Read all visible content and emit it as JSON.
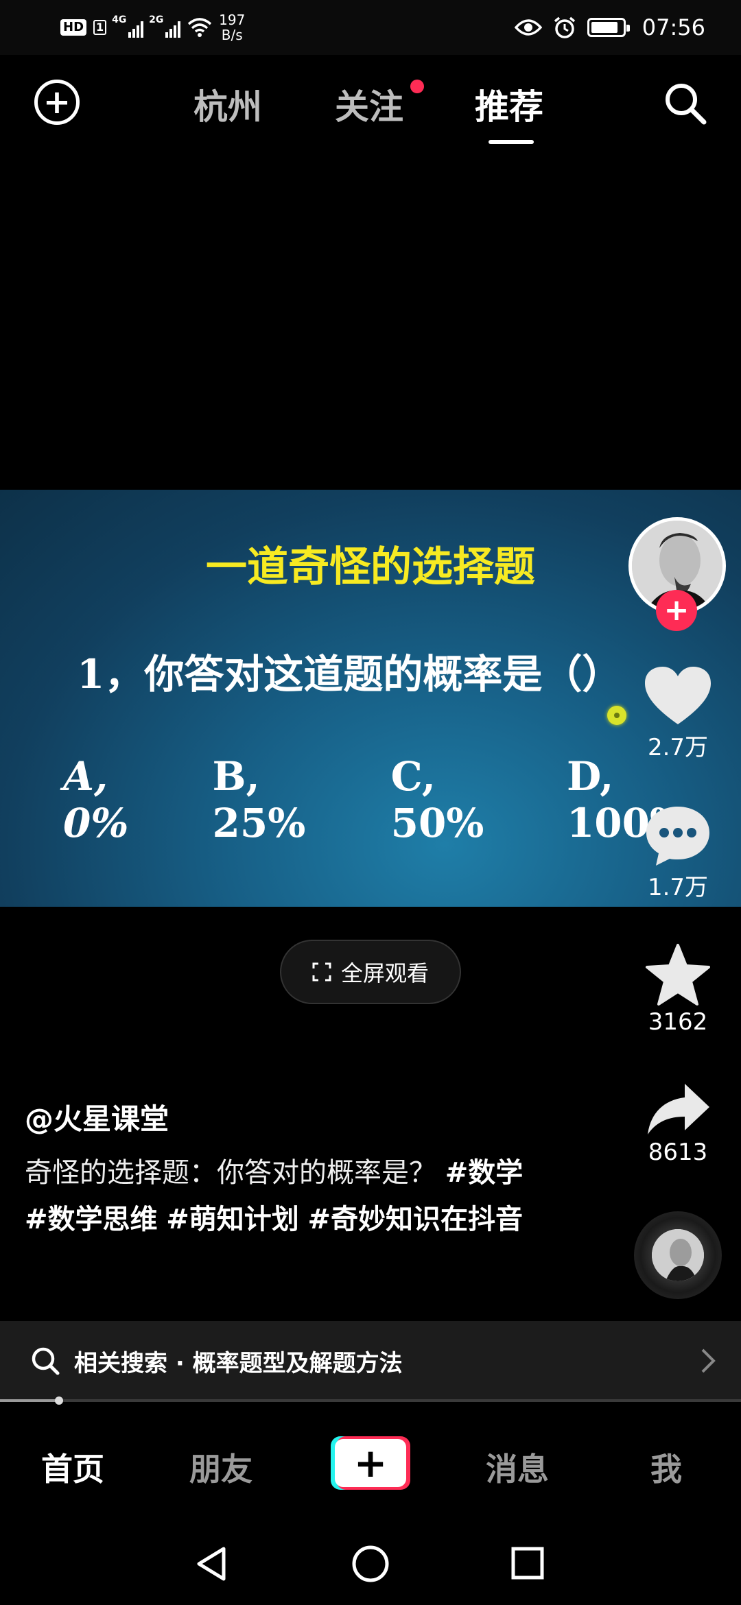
{
  "status_bar": {
    "hd": "HD",
    "sim": "1",
    "net1": "4G",
    "net2": "2G",
    "speed_value": "197",
    "speed_unit": "B/s",
    "time": "07:56"
  },
  "top_nav": {
    "tabs": [
      "杭州",
      "关注",
      "推荐"
    ],
    "active_tab": "推荐",
    "notification_dot_color": "#fe2c55"
  },
  "video": {
    "title": "一道奇怪的选择题",
    "question": "1，你答对这道题的概率是（）",
    "options": [
      "A, 0%",
      "B, 25%",
      "C, 50%",
      "D, 100%"
    ],
    "title_color": "#f7ea22"
  },
  "actions": {
    "likes": "2.7万",
    "comments": "1.7万",
    "favorites": "3162",
    "shares": "8613",
    "follow_plus": "+"
  },
  "fullscreen_button": {
    "label": "全屏观看"
  },
  "caption": {
    "author": "@火星课堂",
    "text": "奇怪的选择题：你答对的概率是？",
    "tags": [
      "#数学",
      "#数学思维",
      "#萌知计划",
      "#奇妙知识在抖音"
    ]
  },
  "related_search": {
    "label": "相关搜索 · 概率题型及解题方法"
  },
  "playback": {
    "progress": 0.08
  },
  "bottom_tabs": {
    "home": "首页",
    "friends": "朋友",
    "create": "+",
    "messages": "消息",
    "me": "我"
  },
  "colors": {
    "accent_red": "#fe2c55",
    "accent_cyan": "#25f4ee",
    "video_blue": "#175f86"
  }
}
